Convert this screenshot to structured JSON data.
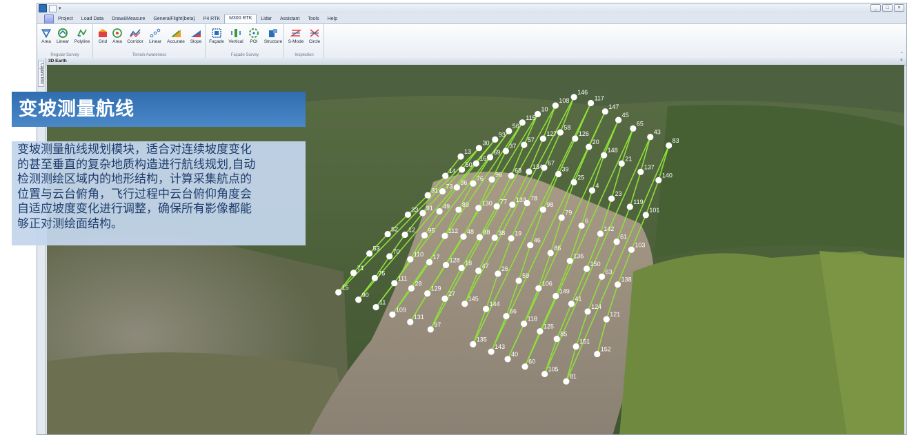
{
  "window": {
    "controls": [
      "_",
      "□",
      "×"
    ]
  },
  "tabs": [
    "Project",
    "Load Data",
    "Draw&Measure",
    "GeneralFlight(beta)",
    "P4 RTK",
    "M300 RTK",
    "Lidar",
    "Assistant",
    "Tools",
    "Help"
  ],
  "active_tab": "M300 RTK",
  "ribbon": {
    "groups": [
      {
        "label": "Regular Survey",
        "buttons": [
          {
            "label": "Area",
            "icon": "area-survey-icon"
          },
          {
            "label": "Linear",
            "icon": "linear-survey-icon"
          },
          {
            "label": "Polyline",
            "icon": "polyline-survey-icon"
          }
        ]
      },
      {
        "label": "Terrain Awareness",
        "buttons": [
          {
            "label": "Grid",
            "icon": "grid-icon"
          },
          {
            "label": "Area",
            "icon": "terrain-area-icon"
          },
          {
            "label": "Corridor",
            "icon": "corridor-icon"
          },
          {
            "label": "Linear",
            "icon": "terrain-linear-icon"
          },
          {
            "label": "Accurate",
            "icon": "accurate-icon"
          },
          {
            "label": "Slope",
            "icon": "slope-icon"
          }
        ]
      },
      {
        "label": "Façade Survey",
        "buttons": [
          {
            "label": "Façade",
            "icon": "facade-icon"
          },
          {
            "label": "Vertical",
            "icon": "vertical-icon"
          },
          {
            "label": "POI",
            "icon": "poi-icon"
          },
          {
            "label": "Structure",
            "icon": "structure-icon"
          }
        ]
      },
      {
        "label": "Inspection",
        "buttons": [
          {
            "label": "S-Mode",
            "icon": "s-mode-icon"
          },
          {
            "label": "Circle",
            "icon": "circle-icon"
          }
        ]
      }
    ]
  },
  "side_tab": "Layers Info",
  "view": {
    "title": "3D Earth",
    "close": "×"
  },
  "overlay": {
    "title": "变坡测量航线",
    "lines": [
      "变坡测量航线规划模块，适合对连续坡度变化",
      "的甚至垂直的复杂地质构造进行航线规划,自动",
      "检测测绘区域内的地形结构，计算采集航点的",
      "位置与云台俯角，飞行过程中云台俯仰角度会",
      "自适应坡度变化进行调整，确保所有影像都能",
      "够正对测绘面结构。"
    ]
  },
  "waypoint_labels": [
    "13",
    "14",
    "31",
    "33",
    "52",
    "53",
    "71",
    "15",
    "30",
    "50",
    "73",
    "91",
    "12",
    "70",
    "75",
    "90",
    "93",
    "16",
    "36",
    "49",
    "95",
    "110",
    "111",
    "11",
    "56",
    "69",
    "76",
    "89",
    "112",
    "17",
    "28",
    "109",
    "115",
    "37",
    "96",
    "130",
    "48",
    "128",
    "129",
    "131",
    "10",
    "57",
    "68",
    "77",
    "88",
    "18",
    "27",
    "97",
    "108",
    "127",
    "134",
    "133",
    "38",
    "47",
    "145",
    "146",
    "58",
    "67",
    "78",
    "19",
    "26",
    "144",
    "135",
    "117",
    "126",
    "39",
    "98",
    "46",
    "59",
    "66",
    "143",
    "147",
    "20",
    "25",
    "79",
    "86",
    "106",
    "118",
    "40",
    "45",
    "148",
    "4",
    "6",
    "136",
    "149",
    "125",
    "60",
    "65",
    "21",
    "23",
    "142",
    "150",
    "41",
    "85",
    "105",
    "43",
    "137",
    "119",
    "61",
    "63",
    "124",
    "151",
    "81",
    "83",
    "140",
    "101",
    "103",
    "138",
    "121",
    "152"
  ],
  "colors": {
    "panel_title_bg": "#3b7bbf",
    "panel_body_bg": "#c4d6ec",
    "route": "#8fe03a"
  }
}
